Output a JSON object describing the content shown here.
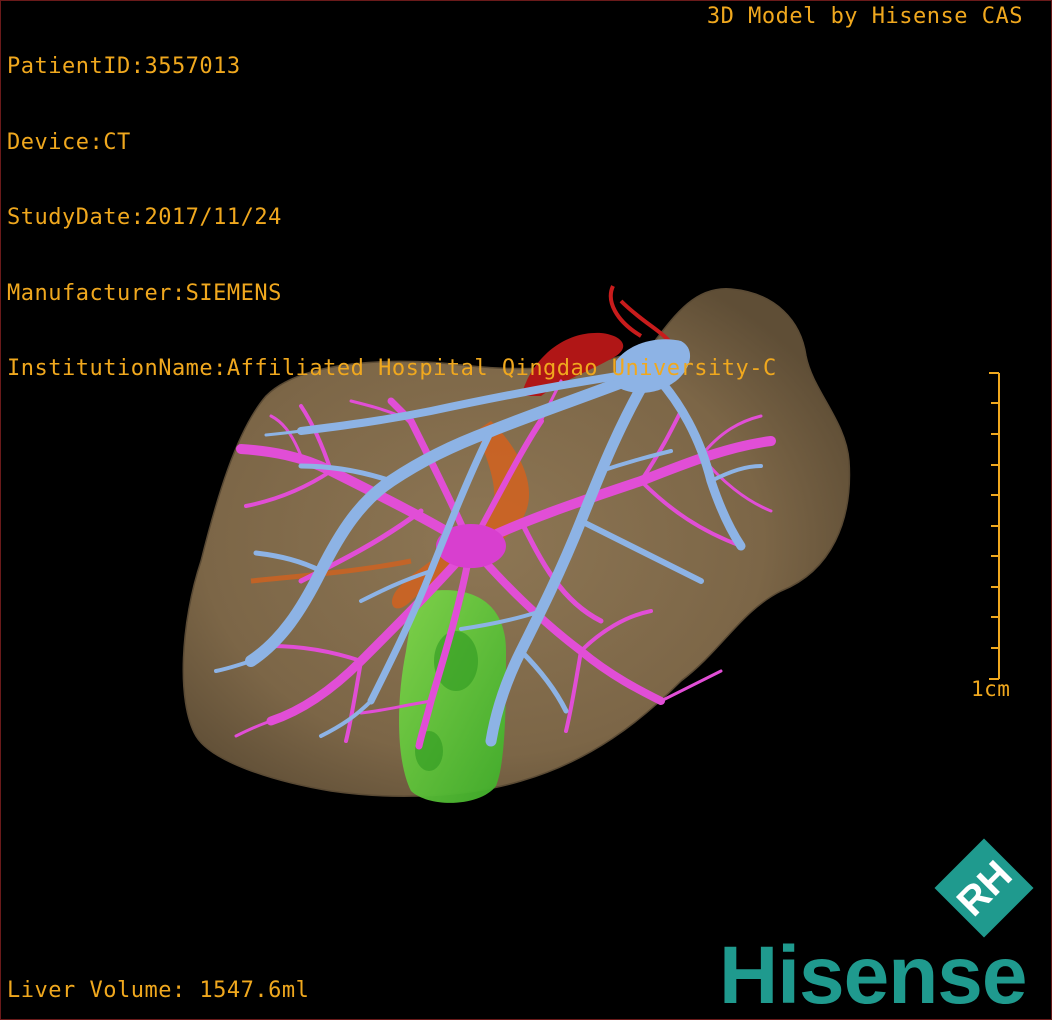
{
  "header": {
    "patient_id": "PatientID:3557013",
    "device": "Device:CT",
    "study_date": "StudyDate:2017/11/24",
    "manufacturer": "Manufacturer:SIEMENS",
    "institution": "InstitutionName:Affiliated Hospital Qingdao University-C"
  },
  "credit": "3D Model by Hisense CAS",
  "footer": {
    "volume": "Liver Volume: 1547.6ml"
  },
  "scale_bar": {
    "label": "1cm"
  },
  "logo": {
    "brand": "Hisense",
    "emblem_letters": "RH"
  },
  "colors": {
    "overlay_text": "#f0a81e",
    "liver": "#8a7250",
    "hepatic_vein": "#8fb4e6",
    "portal_vein": "#e04fd6",
    "artery": "#c01818",
    "gallbladder": "#62c83a",
    "biliary": "#e06a20",
    "brand": "#1f9a8e"
  },
  "model_structures": [
    "liver-surface",
    "hepatic-vein",
    "portal-vein",
    "hepatic-artery",
    "gallbladder",
    "bile-duct"
  ]
}
